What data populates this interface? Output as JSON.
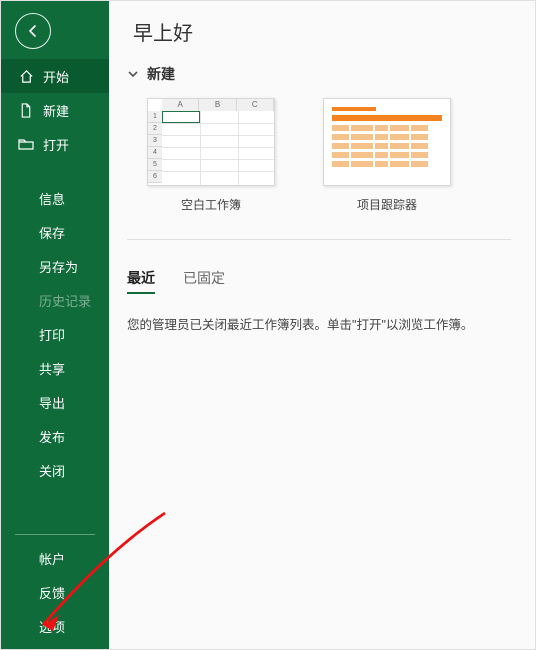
{
  "sidebar": {
    "items": [
      {
        "id": "home",
        "label": "开始",
        "icon": "home-icon"
      },
      {
        "id": "new",
        "label": "新建",
        "icon": "file-icon"
      },
      {
        "id": "open",
        "label": "打开",
        "icon": "folder-icon"
      },
      {
        "id": "info",
        "label": "信息"
      },
      {
        "id": "save",
        "label": "保存"
      },
      {
        "id": "saveas",
        "label": "另存为"
      },
      {
        "id": "history",
        "label": "历史记录",
        "disabled": true
      },
      {
        "id": "print",
        "label": "打印"
      },
      {
        "id": "share",
        "label": "共享"
      },
      {
        "id": "export",
        "label": "导出"
      },
      {
        "id": "publish",
        "label": "发布"
      },
      {
        "id": "close",
        "label": "关闭"
      }
    ],
    "bottomItems": [
      {
        "id": "account",
        "label": "帐户"
      },
      {
        "id": "feedback",
        "label": "反馈"
      },
      {
        "id": "options",
        "label": "选项"
      }
    ]
  },
  "main": {
    "title": "早上好",
    "newSection": "新建",
    "templates": [
      {
        "id": "blank",
        "label": "空白工作簿"
      },
      {
        "id": "tracker",
        "label": "项目跟踪器"
      }
    ],
    "tabs": {
      "recent": "最近",
      "pinned": "已固定"
    },
    "recentMessage": "您的管理员已关闭最近工作簿列表。单击\"打开\"以浏览工作簿。"
  }
}
